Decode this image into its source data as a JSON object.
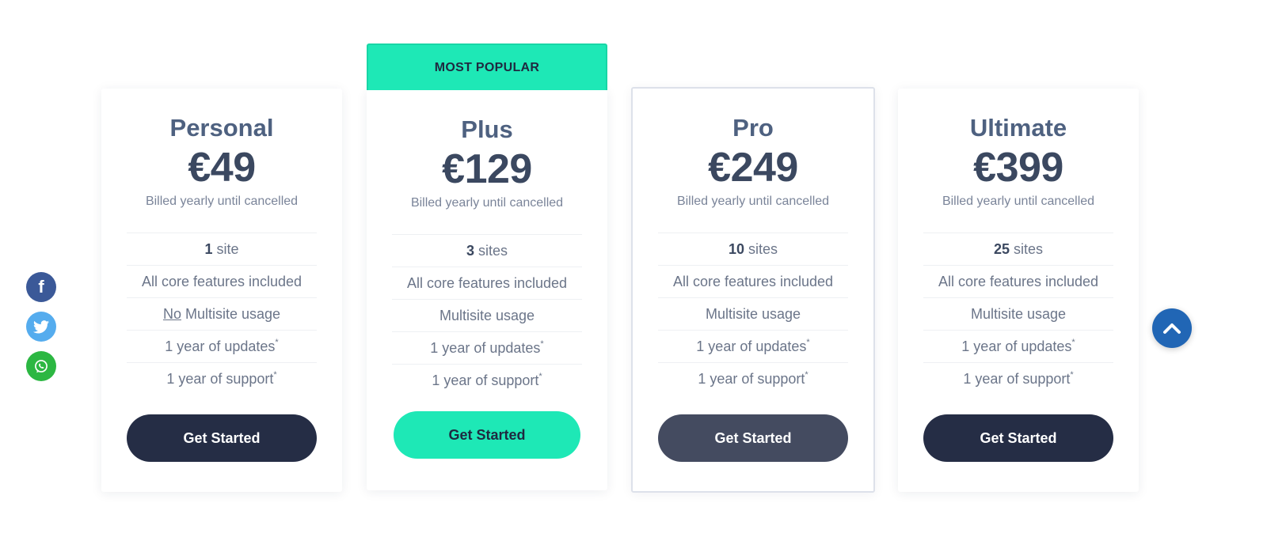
{
  "plans": [
    {
      "name": "Personal",
      "price": "€49",
      "billing": "Billed yearly until cancelled",
      "sites_count": "1",
      "sites_label": " site",
      "core": "All core features included",
      "multisite_prefix": "No",
      "multisite": " Multisite usage",
      "updates": "1 year of updates",
      "support": "1 year of support",
      "footnote_mark": "*",
      "cta": "Get Started",
      "cta_color": "#252d45"
    },
    {
      "name": "Plus",
      "badge": "MOST POPULAR",
      "price": "€129",
      "billing": "Billed yearly until cancelled",
      "sites_count": "3",
      "sites_label": " sites",
      "core": "All core features included",
      "multisite": "Multisite usage",
      "updates": "1 year of updates",
      "support": "1 year of support",
      "footnote_mark": "*",
      "cta": "Get Started",
      "cta_color": "#1ee8b6"
    },
    {
      "name": "Pro",
      "price": "€249",
      "billing": "Billed yearly until cancelled",
      "sites_count": "10",
      "sites_label": " sites",
      "core": "All core features included",
      "multisite": "Multisite usage",
      "updates": "1 year of updates",
      "support": "1 year of support",
      "footnote_mark": "*",
      "cta": "Get Started",
      "cta_color": "#444b60"
    },
    {
      "name": "Ultimate",
      "price": "€399",
      "billing": "Billed yearly until cancelled",
      "sites_count": "25",
      "sites_label": " sites",
      "core": "All core features included",
      "multisite": "Multisite usage",
      "updates": "1 year of updates",
      "support": "1 year of support",
      "footnote_mark": "*",
      "cta": "Get Started",
      "cta_color": "#252d45"
    }
  ],
  "social": [
    {
      "icon": "facebook-icon",
      "glyph": "f",
      "color": "#3b5998"
    },
    {
      "icon": "twitter-icon",
      "glyph": "🐦",
      "color": "#55acee"
    },
    {
      "icon": "whatsapp-icon",
      "glyph": "✆",
      "color": "#2cb742"
    }
  ],
  "scroll_top": {
    "icon": "chevron-up-icon",
    "color": "#2166b5"
  },
  "colors": {
    "accent": "#1ee8b6",
    "dark": "#252d45",
    "text": "#3b4860"
  }
}
